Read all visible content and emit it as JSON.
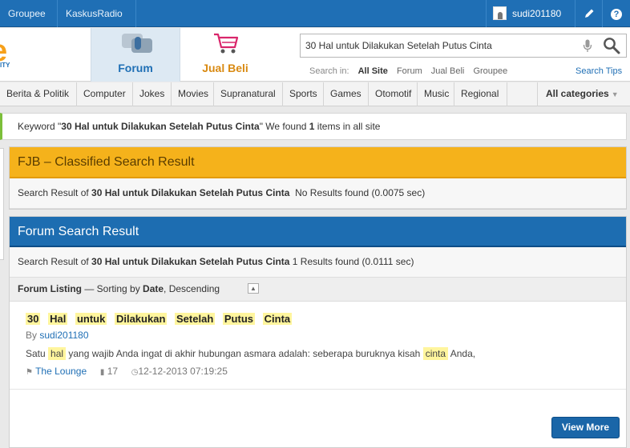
{
  "topbar": {
    "groupee": "Groupee",
    "radio": "KaskusRadio",
    "username": "sudi201180"
  },
  "header": {
    "logo_sub": "ITY",
    "tabs": [
      {
        "label": "Forum",
        "active": true,
        "icon": "forum-icon"
      },
      {
        "label": "Jual Beli",
        "active": false,
        "icon": "cart-icon"
      }
    ],
    "search": {
      "value": "30 Hal untuk Dilakukan Setelah Putus Cinta",
      "search_in_label": "Search in:",
      "options": [
        "All Site",
        "Forum",
        "Jual Beli",
        "Groupee"
      ],
      "tips": "Search Tips"
    }
  },
  "categories": [
    "Berita & Politik",
    "Computer",
    "Jokes",
    "Movies",
    "Supranatural",
    "Sports",
    "Games",
    "Otomotif",
    "Music",
    "Regional"
  ],
  "all_categories": "All categories",
  "keyword_bar": {
    "prefix": "Keyword \"",
    "keyword": "30 Hal untuk Dilakukan Setelah Putus Cinta",
    "mid": "\" We found ",
    "count": "1",
    "suffix": " items in all site"
  },
  "fjb": {
    "title": "FJB – Classified Search Result",
    "prefix": "Search Result of ",
    "keyword": "30 Hal untuk Dilakukan Setelah Putus Cinta",
    "result": "No Results found (0.0075 sec)"
  },
  "forum_result": {
    "title": "Forum Search Result",
    "prefix": "Search Result of ",
    "keyword": "30 Hal untuk Dilakukan Setelah Putus Cinta",
    "result": "1 Results found (0.0111 sec)",
    "listing_label": "Forum Listing",
    "sort_prefix": " — Sorting by ",
    "sort_key": "Date",
    "sort_order": ", Descending",
    "items": [
      {
        "title_words": [
          "30",
          "Hal",
          "untuk",
          "Dilakukan",
          "Setelah",
          "Putus",
          "Cinta"
        ],
        "by_label": "By ",
        "author": "sudi201180",
        "snippet": [
          {
            "text": "Satu ",
            "hl": false
          },
          {
            "text": "hal",
            "hl": true
          },
          {
            "text": " yang wajib Anda ingat di akhir hubungan asmara adalah: seberapa buruknya kisah ",
            "hl": false
          },
          {
            "text": "cinta",
            "hl": true
          },
          {
            "text": " Anda,",
            "hl": false
          }
        ],
        "forum": "The Lounge",
        "replies": "17",
        "date": "12-12-2013 07:19:25"
      }
    ],
    "view_more": "View More"
  },
  "colors": {
    "topbar": "#1f6fb5",
    "fjb_header": "#f5b21b",
    "forum_header": "#1d6db1",
    "highlight": "#fff59d",
    "keyword_accent": "#7cbf3a"
  }
}
